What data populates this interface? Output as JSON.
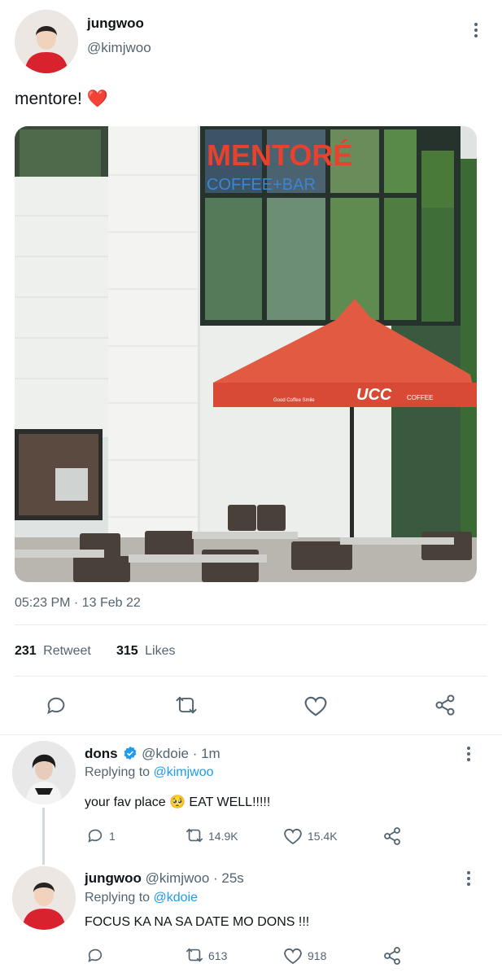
{
  "tweet": {
    "author_name": "jungwoo",
    "author_handle": "@kimjwoo",
    "text": "mentore!",
    "emoji": "❤️",
    "timestamp": "05:23 PM · 13 Feb 22",
    "photo": {
      "sign_line1": "MENTORÉ",
      "sign_line2": "COFFEE+BAR",
      "umbrella_brand": "UCC",
      "umbrella_sub": "COFFEE",
      "umbrella_tag": "Good Coffee Smile"
    },
    "retweets_count": "231",
    "retweets_label": "Retweet",
    "likes_count": "315",
    "likes_label": "Likes"
  },
  "replies": [
    {
      "name": "dons",
      "verified": true,
      "handle": "@kdoie",
      "time": "· 1m",
      "replying_label": "Replying to",
      "replying_to": "@kimjwoo",
      "text": "your fav place 🥺 EAT WELL!!!!!",
      "reply_count": "1",
      "retweet_count": "14.9K",
      "like_count": "15.4K"
    },
    {
      "name": "jungwoo",
      "verified": false,
      "handle": "@kimjwoo",
      "time": "· 25s",
      "replying_label": "Replying to",
      "replying_to": "@kdoie",
      "text": "FOCUS KA NA SA DATE MO DONS !!!",
      "reply_count": "",
      "retweet_count": "613",
      "like_count": "918"
    }
  ],
  "colors": {
    "accent": "#1d9bf0",
    "secondary_text": "#536471",
    "umbrella": "#e35a42"
  }
}
